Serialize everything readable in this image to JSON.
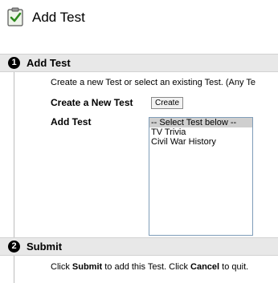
{
  "page": {
    "title": "Add Test"
  },
  "steps": [
    {
      "number": "1",
      "label": "Add Test"
    },
    {
      "number": "2",
      "label": "Submit"
    }
  ],
  "add_test": {
    "instructions": "Create a new Test or select an existing Test. (Any Te",
    "create_label": "Create a New Test",
    "create_button": "Create",
    "select_label": "Add Test",
    "options": [
      "-- Select Test below --",
      "TV Trivia",
      "Civil War History"
    ],
    "selected_index": 0
  },
  "submit": {
    "text_1": "Click ",
    "bold_1": "Submit",
    "text_2": " to add this Test. Click ",
    "bold_2": "Cancel",
    "text_3": " to quit."
  }
}
